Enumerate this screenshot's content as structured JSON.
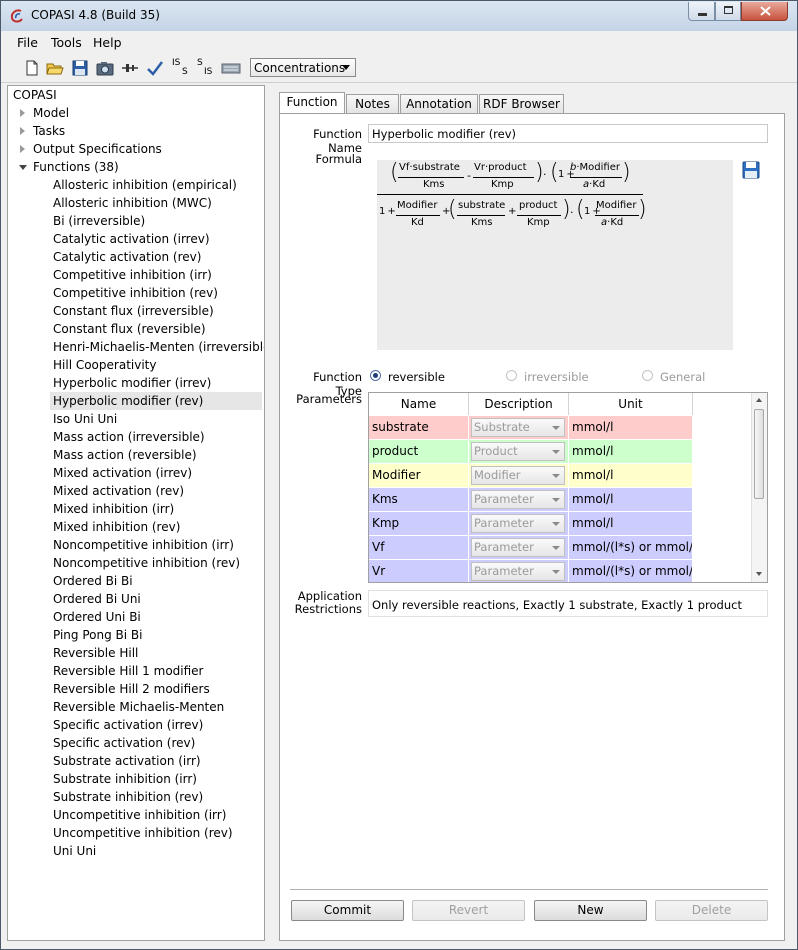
{
  "window": {
    "title": "COPASI 4.8 (Build 35)"
  },
  "menu": [
    "File",
    "Tools",
    "Help"
  ],
  "toolbar": {
    "icons": [
      "new-file-icon",
      "open-folder-icon",
      "save-icon",
      "camera-icon",
      "sliders-icon",
      "check-icon",
      "is-s-icon",
      "s-is-icon",
      "parameter-overview-icon"
    ],
    "is_s": {
      "top": "IS",
      "bottom": "S"
    },
    "s_is": {
      "top": "S",
      "bottom": "IS"
    },
    "concentration_select": "Concentrations"
  },
  "tree": {
    "root": "COPASI",
    "nodes": [
      "Model",
      "Tasks",
      "Output Specifications"
    ],
    "functions_label": "Functions (38)",
    "functions": [
      "Allosteric inhibition (empirical)",
      "Allosteric inhibition (MWC)",
      "Bi (irreversible)",
      "Catalytic activation (irrev)",
      "Catalytic activation (rev)",
      "Competitive inhibition (irr)",
      "Competitive inhibition (rev)",
      "Constant flux (irreversible)",
      "Constant flux (reversible)",
      "Henri-Michaelis-Menten (irreversible)",
      "Hill Cooperativity",
      "Hyperbolic modifier (irrev)",
      "Hyperbolic modifier (rev)",
      "Iso Uni Uni",
      "Mass action (irreversible)",
      "Mass action (reversible)",
      "Mixed activation (irrev)",
      "Mixed activation (rev)",
      "Mixed inhibition (irr)",
      "Mixed inhibition (rev)",
      "Noncompetitive inhibition (irr)",
      "Noncompetitive inhibition (rev)",
      "Ordered Bi Bi",
      "Ordered Bi Uni",
      "Ordered Uni Bi",
      "Ping Pong Bi Bi",
      "Reversible Hill",
      "Reversible Hill 1 modifier",
      "Reversible Hill 2 modifiers",
      "Reversible Michaelis-Menten",
      "Specific activation (irrev)",
      "Specific activation (rev)",
      "Substrate activation (irr)",
      "Substrate inhibition (irr)",
      "Substrate inhibition (rev)",
      "Uncompetitive inhibition (irr)",
      "Uncompetitive inhibition (rev)",
      "Uni Uni"
    ],
    "selected_index": 12
  },
  "tabs": [
    "Function",
    "Notes",
    "Annotation",
    "RDF Browser"
  ],
  "form": {
    "function_name_label": "Function Name",
    "function_name": "Hyperbolic modifier (rev)",
    "formula_label": "Formula",
    "formula": {
      "vf": "Vf",
      "substrate": "substrate",
      "kms": "Kms",
      "vr": "Vr",
      "product": "product",
      "kmp": "Kmp",
      "b": "b",
      "modifier": "Modifier",
      "a": "a",
      "kd": "Kd",
      "one": "1",
      "dot": "·",
      "minus": "-",
      "plus": "+"
    },
    "function_type_label": "Function Type",
    "function_types": [
      "reversible",
      "irreversible",
      "General"
    ],
    "function_type_selected": 0,
    "parameters_label": "Parameters",
    "param_headers": [
      "Name",
      "Description",
      "Unit"
    ],
    "params": [
      {
        "name": "substrate",
        "desc": "Substrate",
        "unit": "mmol/l",
        "color": "#ffcccc"
      },
      {
        "name": "product",
        "desc": "Product",
        "unit": "mmol/l",
        "color": "#ccffcc"
      },
      {
        "name": "Modifier",
        "desc": "Modifier",
        "unit": "mmol/l",
        "color": "#ffffcc"
      },
      {
        "name": "Kms",
        "desc": "Parameter",
        "unit": "mmol/l",
        "color": "#ccccff"
      },
      {
        "name": "Kmp",
        "desc": "Parameter",
        "unit": "mmol/l",
        "color": "#ccccff"
      },
      {
        "name": "Vf",
        "desc": "Parameter",
        "unit": "mmol/(l*s) or mmol/s",
        "color": "#ccccff"
      },
      {
        "name": "Vr",
        "desc": "Parameter",
        "unit": "mmol/(l*s) or mmol/s",
        "color": "#ccccff"
      }
    ],
    "app_restr_label_1": "Application",
    "app_restr_label_2": "Restrictions",
    "app_restr": "Only reversible reactions, Exactly 1 substrate, Exactly 1 product"
  },
  "buttons": {
    "commit": "Commit",
    "revert": "Revert",
    "new": "New",
    "delete": "Delete"
  }
}
